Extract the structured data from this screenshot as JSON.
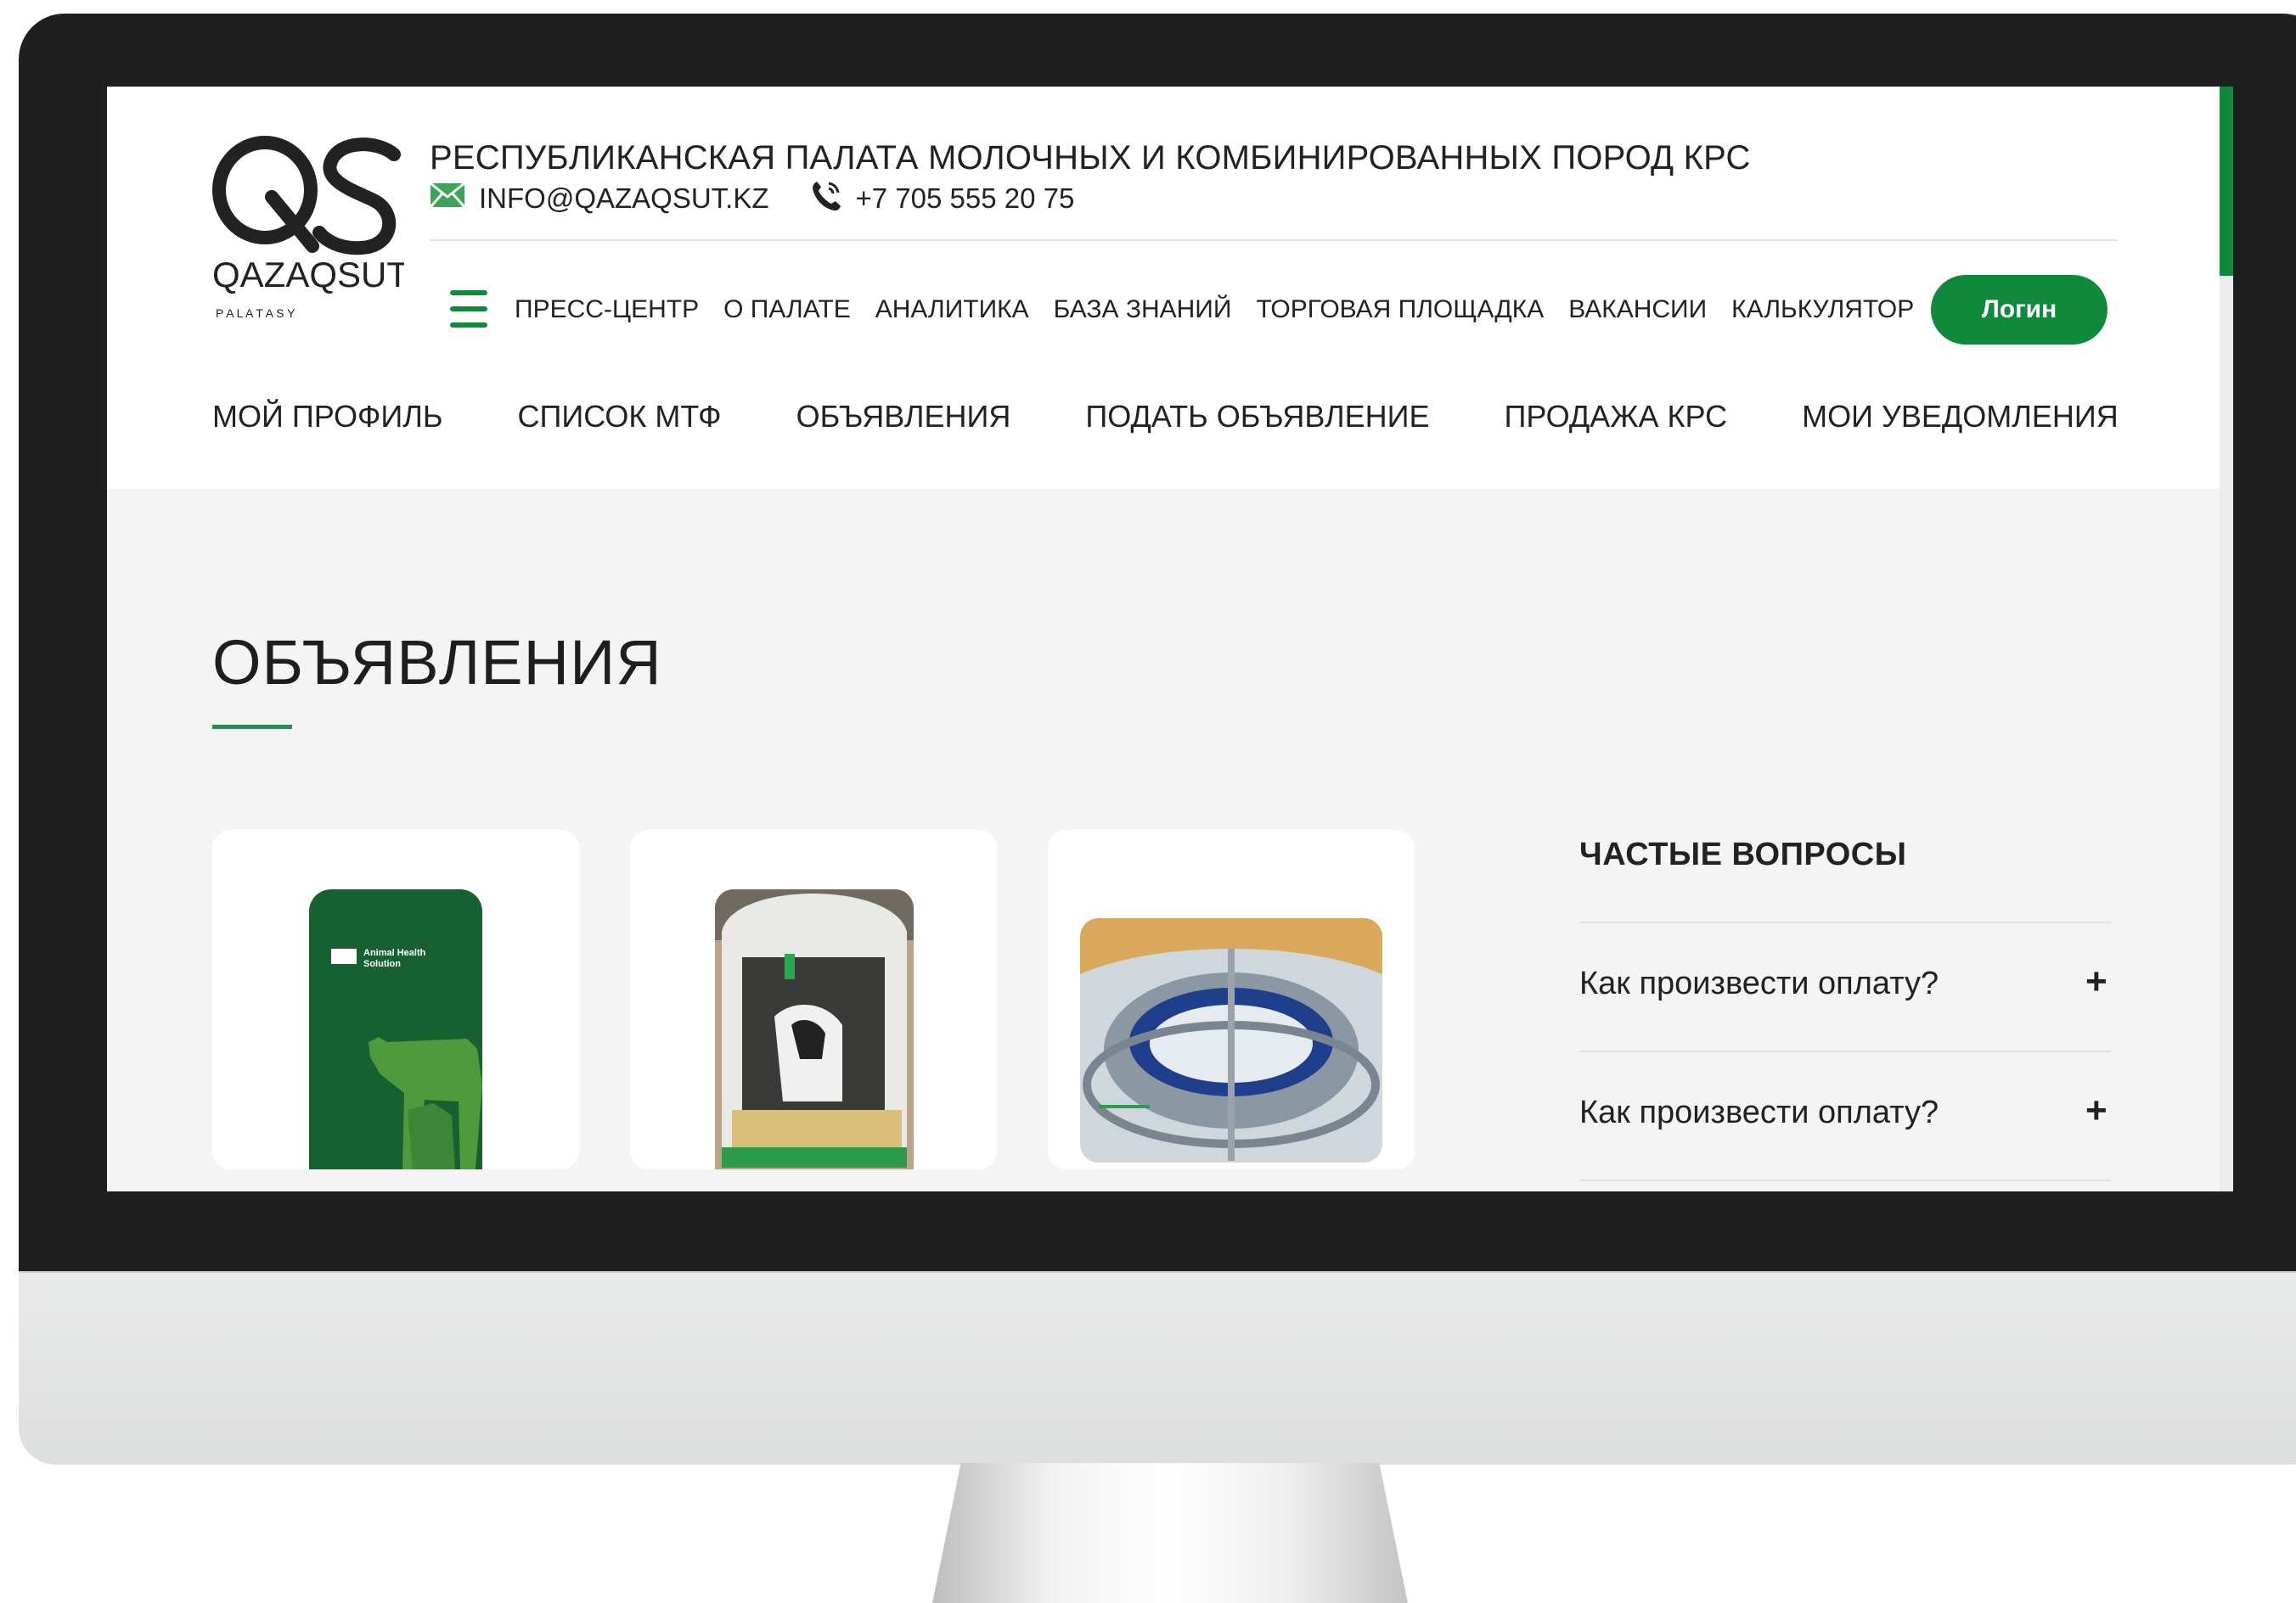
{
  "brand": {
    "logo_letters": "QS",
    "logo_name": "QAZAQSUT",
    "logo_sub": "P A L A T A S Y"
  },
  "header": {
    "org_title": "РЕСПУБЛИКАНСКАЯ ПАЛАТА МОЛОЧНЫХ И КОМБИНИРОВАННЫХ ПОРОД КРС",
    "email": "INFO@QAZAQSUT.KZ",
    "phone": "+7 705 555 20 75",
    "email_icon": "envelope-icon",
    "phone_icon": "phone-icon",
    "menu_icon": "hamburger-menu-icon"
  },
  "top_nav": {
    "items": [
      "ПРЕСС-ЦЕНТР",
      "О ПАЛАТЕ",
      "АНАЛИТИКА",
      "БАЗА ЗНАНИЙ",
      "ТОРГОВАЯ ПЛОЩАДКА",
      "ВАКАНСИИ",
      "КАЛЬКУЛЯТОР"
    ],
    "login_label": "Логин"
  },
  "sub_nav": {
    "items": [
      "МОЙ ПРОФИЛЬ",
      "СПИСОК МТФ",
      "ОБЪЯВЛЕНИЯ",
      "ПОДАТЬ ОБЪЯВЛЕНИЕ",
      "ПРОДАЖА КРС",
      "МОИ УВЕДОМЛЕНИЯ"
    ]
  },
  "main": {
    "page_title": "ОБЪЯВЛЕНИЯ",
    "cards": [
      {
        "image": "animal-health-solution-product-image",
        "image_text": "Animal Health Solution"
      },
      {
        "image": "calf-hutch-image"
      },
      {
        "image": "rotary-milking-parlor-image"
      }
    ]
  },
  "faq": {
    "title": "ЧАСТЫЕ ВОПРОСЫ",
    "items": [
      {
        "question": "Как произвести оплату?",
        "toggle": "+"
      },
      {
        "question": "Как произвести оплату?",
        "toggle": "+"
      }
    ]
  },
  "colors": {
    "accent": "#0e8a3a",
    "page_bg": "#f4f4f4",
    "bezel": "#1f1f1f"
  }
}
